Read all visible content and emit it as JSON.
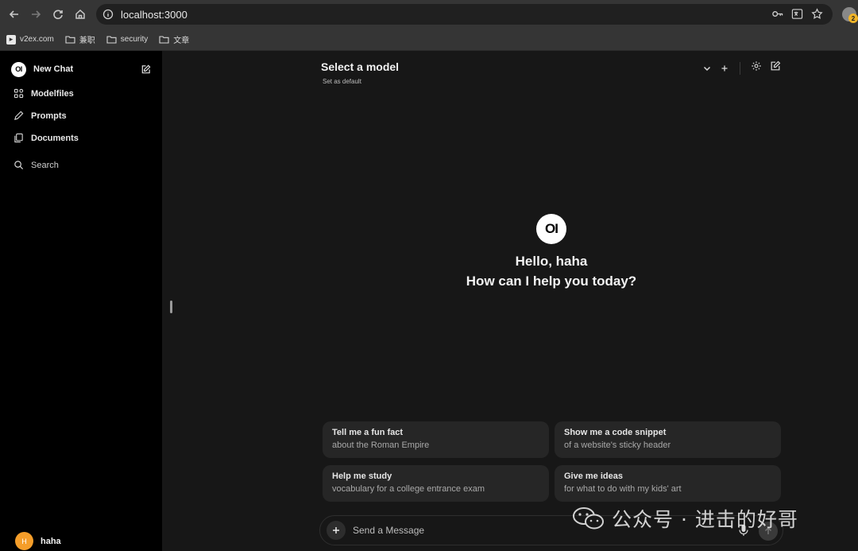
{
  "browser": {
    "url": "localhost:3000",
    "extension_badge": "2",
    "bookmarks": [
      {
        "label": "v2ex.com",
        "icon": "v2ex-favicon"
      },
      {
        "label": "兼职",
        "icon": "folder-icon"
      },
      {
        "label": "security",
        "icon": "folder-icon"
      },
      {
        "label": "文章",
        "icon": "folder-icon"
      }
    ]
  },
  "sidebar": {
    "logo_text": "OI",
    "new_chat": "New Chat",
    "items": [
      {
        "label": "Modelfiles",
        "icon": "modelfiles-icon"
      },
      {
        "label": "Prompts",
        "icon": "pencil-icon"
      },
      {
        "label": "Documents",
        "icon": "documents-icon"
      }
    ],
    "search_label": "Search",
    "user": {
      "initial": "H",
      "name": "haha"
    }
  },
  "main": {
    "model_select": "Select a model",
    "set_default": "Set as default",
    "logo_text": "OI",
    "greeting": "Hello, haha",
    "prompt_question": "How can I help you today?",
    "suggestions": [
      {
        "title": "Tell me a fun fact",
        "subtitle": "about the Roman Empire"
      },
      {
        "title": "Show me a code snippet",
        "subtitle": "of a website's sticky header"
      },
      {
        "title": "Help me study",
        "subtitle": "vocabulary for a college entrance exam"
      },
      {
        "title": "Give me ideas",
        "subtitle": "for what to do with my kids' art"
      }
    ],
    "composer_placeholder": "Send a Message"
  },
  "watermark": {
    "text": "公众号 · 进击的好哥"
  },
  "colors": {
    "background": "#171717",
    "sidebar": "#000000",
    "card": "#262626",
    "avatar": "#f59e2a"
  }
}
